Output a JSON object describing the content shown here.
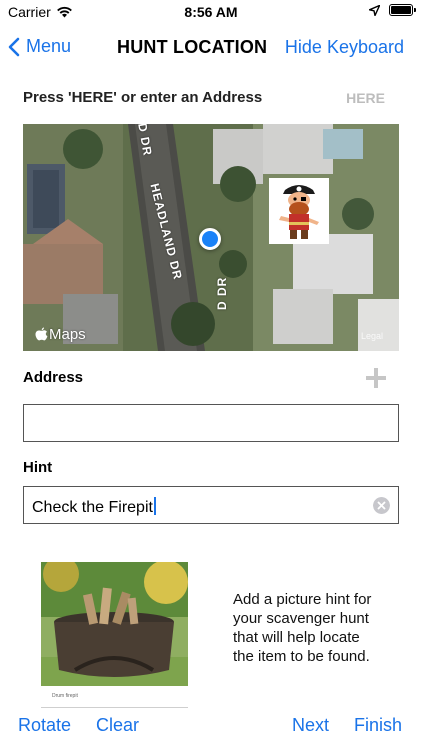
{
  "status_bar": {
    "carrier": "Carrier",
    "time": "8:56 AM",
    "battery_level": 1.0
  },
  "nav": {
    "back_label": "Menu",
    "title": "HUNT LOCATION",
    "right_label": "Hide Keyboard"
  },
  "location": {
    "prompt": "Press 'HERE' or enter an Address",
    "here_label": "HERE"
  },
  "map": {
    "road_labels": [
      "D DR",
      "HEADLAND DR",
      "D DR"
    ],
    "logo_text": "Maps",
    "legal_text": "Legal",
    "pin_icon": "pirate-icon",
    "location_color": "#1a82f7"
  },
  "address": {
    "label": "Address",
    "value": "",
    "placeholder": ""
  },
  "hint": {
    "label": "Hint",
    "value": "Check the Firepit"
  },
  "picture_hint": {
    "photo_caption": "Drum firepit",
    "text": "Add a picture hint for your scavenger hunt that will help locate the item to be found."
  },
  "toolbar": {
    "rotate": "Rotate",
    "clear": "Clear",
    "next": "Next",
    "finish": "Finish"
  },
  "colors": {
    "accent": "#1a73e8",
    "disabled": "#bdbdbd"
  }
}
